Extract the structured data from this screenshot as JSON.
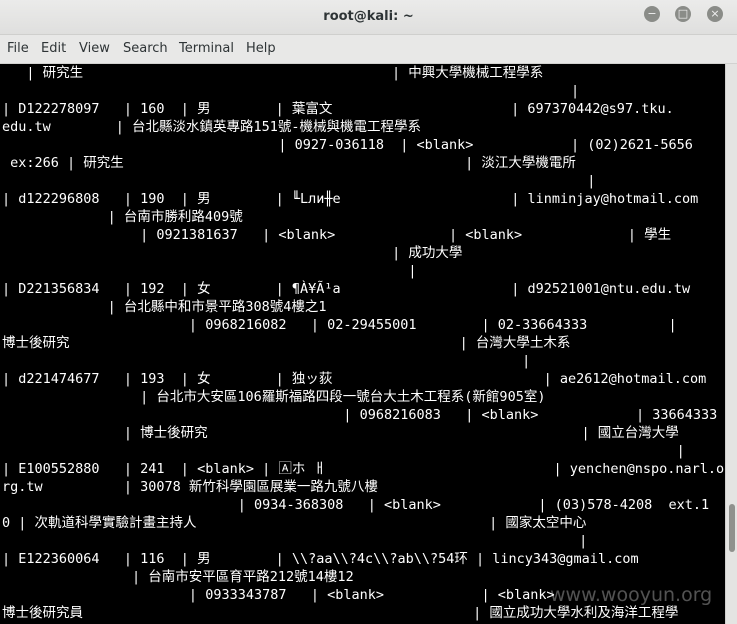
{
  "window": {
    "title": "root@kali: ~",
    "minimize_label": "−",
    "maximize_label": "□",
    "close_label": "×"
  },
  "menu": {
    "items": [
      "File",
      "Edit",
      "View",
      "Search",
      "Terminal",
      "Help"
    ]
  },
  "terminal": {
    "lines": [
      "   | 研究生                                      | 中興大學機械工程學系",
      "                                                                      |",
      "| D122278097   | 160  | 男        | 葉富文                      | 697370442@s97.tku.",
      "edu.tw        | 台北縣淡水鎮英專路151號-機械與機電工程學系",
      "                                  | 0927-036118  | <blank>            | (02)2621-5656",
      " ex:266 | 研究生                                          | 淡江大學機電所",
      "                                                                        |",
      "| d122296808   | 190  | 男        | ╙Lли╫e                     | linminjay@hotmail.com",
      "             | 台南市勝利路409號",
      "                 | 0921381637   | <blank>              | <blank>             | 學生",
      "                                                | 成功大學",
      "                                                  |",
      "| D221356834   | 192  | 女        | ¶À¥Ã¹a                     | d92521001@ntu.edu.tw",
      "             | 台北縣中和市景平路308號4樓之1",
      "                       | 0968216082   | 02-29455001        | 02-33664333          |",
      "博士後研究                                                | 台灣大學土木系",
      "                                                                |",
      "| d221474677   | 193  | 女        | 独ッ荻                          | ae2612@hotmail.com",
      "                 | 台北市大安區106羅斯福路四段一號台大土木工程系(新館905室)",
      "                                          | 0968216083   | <blank>            | 33664333",
      "               | 博士後研究                                              | 國立台灣大學",
      "                                                                                   |",
      "| E100552880   | 241  | <blank> | 🄰ホ ㅐ                            | yenchen@nspo.narl.o",
      "rg.tw          | 30078 新竹科學園區展業一路九號八樓",
      "                             | 0934-368308   | <blank>            | (03)578-4208  ext.1",
      "0 | 次軌道科學實驗計畫主持人                                    | 國家太空中心",
      "                                                                       |",
      "| E122360064   | 116  | 男        | \\\\?aa\\\\?4c\\\\?ab\\\\?54环 | lincy343@gmail.com",
      "                | 台南市安平區育平路212號14樓12",
      "                       | 0933343787   | <blank>            | <blank>",
      "博士後研究員                                                | 國立成功大學水利及海洋工程學"
    ]
  },
  "watermark": "www.wooyun.org"
}
